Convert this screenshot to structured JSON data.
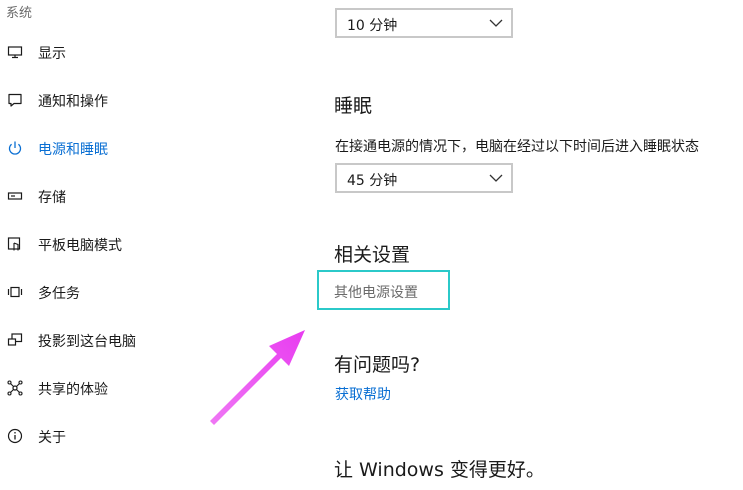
{
  "sidebar": {
    "section_label": "系统",
    "items": [
      {
        "label": "显示",
        "icon": "monitor-icon"
      },
      {
        "label": "通知和操作",
        "icon": "notification-icon"
      },
      {
        "label": "电源和睡眠",
        "icon": "power-icon",
        "active": true
      },
      {
        "label": "存储",
        "icon": "storage-icon"
      },
      {
        "label": "平板电脑模式",
        "icon": "tablet-mode-icon"
      },
      {
        "label": "多任务",
        "icon": "multitask-icon"
      },
      {
        "label": "投影到这台电脑",
        "icon": "project-icon"
      },
      {
        "label": "共享的体验",
        "icon": "shared-experience-icon"
      },
      {
        "label": "关于",
        "icon": "info-icon"
      }
    ]
  },
  "main": {
    "screen_timeout_value": "10 分钟",
    "sleep": {
      "title": "睡眠",
      "description": "在接通电源的情况下，电脑在经过以下时间后进入睡眠状态",
      "value": "45 分钟"
    },
    "related": {
      "title": "相关设置",
      "link": "其他电源设置"
    },
    "help": {
      "title": "有问题吗?",
      "link": "获取帮助"
    },
    "feedback_title": "让 Windows 变得更好。"
  },
  "colors": {
    "accent": "#0a6fd3",
    "highlight_box": "#2bc9c9",
    "arrow": "#e83cf0"
  }
}
